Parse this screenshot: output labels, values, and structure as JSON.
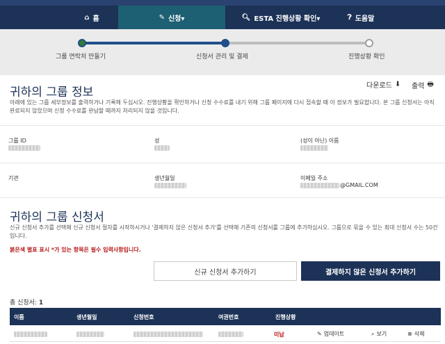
{
  "nav": {
    "home": {
      "icon": "home-icon",
      "label": "홈"
    },
    "apply": {
      "icon": "pencil-icon",
      "label": "신청▾"
    },
    "status": {
      "icon": "search-icon",
      "label": "ESTA 진행상황 확인▾"
    },
    "help": {
      "icon": "question-circle-icon",
      "label": "도움말"
    }
  },
  "steps": [
    {
      "label": "그룹 연락처 만들기",
      "state": "complete"
    },
    {
      "label": "신청서 관리 및 결제",
      "state": "current"
    },
    {
      "label": "진행상황 확인",
      "state": "pending"
    }
  ],
  "group_info": {
    "title": "귀하의 그룹 정보",
    "download_label": "다운로드",
    "print_label": "출력",
    "description": "아래에 있는 그룹 세부정보를 출력하거나 기록해 두십시오. 진행상황을 확인하거나 신청 수수료를 내기 위해 그룹 페이지에 다시 접속할 때 이 정보가 필요합니다. 본 그룹 신청서는 아직 완료되지 않았으며 신청 수수료를 완납할 때까지 처리되지 않을 것입니다.",
    "fields": {
      "group_id_label": "그룹 ID",
      "surname_label": "성",
      "given_name_label": "(성이 아닌) 이름",
      "organization_label": "기관",
      "dob_label": "생년월일",
      "email_label": "이메일 주소",
      "email_value_suffix": "@GMAIL.COM"
    }
  },
  "applications": {
    "title": "귀하의 그룹 신청서",
    "description": "신규 신청서 추가를 선택해 신규 신청서 절차를 시작하시거나 '결제하지 않은 신청서 추가'를 선택해 기존의 신청서를 그룹에 추가하십시오. 그룹으로 묶을 수 있는 최대 신청서 수는 50건입니다.",
    "required_note": "붉은색 별표 표시 *가 있는 항목은 필수 입력사항입니다.",
    "add_new_button": "신규 신청서 추가하기",
    "add_unpaid_button": "결제하지 않은 신청서 추가하기",
    "total_label": "총 신청서:",
    "total_count": "1",
    "columns": [
      "이름",
      "생년월일",
      "신청번호",
      "여권번호",
      "진행상황"
    ],
    "rows": [
      {
        "status": "미납",
        "update_label": "업데이트",
        "view_label": "보기",
        "delete_label": "삭제"
      }
    ]
  }
}
